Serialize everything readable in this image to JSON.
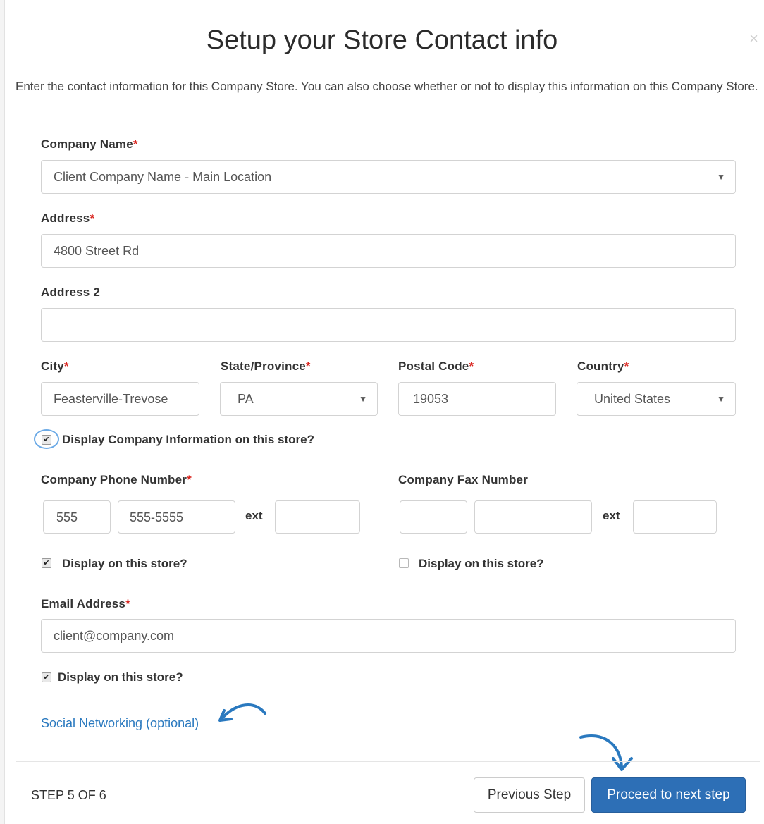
{
  "modal": {
    "title": "Setup your Store Contact info",
    "close_symbol": "×",
    "intro": "Enter the contact information for this Company Store. You can also choose whether or not to display this information on this Company Store."
  },
  "required_marker": "*",
  "form": {
    "company_name": {
      "label": "Company Name",
      "value": "Client Company Name - Main Location"
    },
    "address": {
      "label": "Address",
      "value": "4800 Street Rd"
    },
    "address2": {
      "label": "Address 2",
      "value": ""
    },
    "city": {
      "label": "City",
      "value": "Feasterville-Trevose"
    },
    "state": {
      "label": "State/Province",
      "value": "PA"
    },
    "postal": {
      "label": "Postal Code",
      "value": "19053"
    },
    "country": {
      "label": "Country",
      "value": "United States"
    },
    "display_company": {
      "label": "Display Company Information on this store?",
      "checked": true
    },
    "phone": {
      "label": "Company Phone Number",
      "area": "555",
      "number": "555-5555",
      "ext_label": "ext",
      "ext": "",
      "display_label": "Display on this store?",
      "display_checked": true
    },
    "fax": {
      "label": "Company Fax Number",
      "area": "",
      "number": "",
      "ext_label": "ext",
      "ext": "",
      "display_label": "Display on this store?",
      "display_checked": false
    },
    "email": {
      "label": "Email Address",
      "value": "client@company.com",
      "display_label": "Display on this store?",
      "display_checked": true
    },
    "social_link": "Social Networking (optional)"
  },
  "footer": {
    "step": "STEP 5 OF 6",
    "prev_label": "Previous Step",
    "next_label": "Proceed to next step"
  },
  "icons": {
    "select_caret": "▼",
    "checkmark": "✔"
  },
  "colors": {
    "accent": "#2d6fb6",
    "link": "#2a79bf",
    "required": "#d9231d",
    "annotation_arrow": "#2a79bf"
  }
}
